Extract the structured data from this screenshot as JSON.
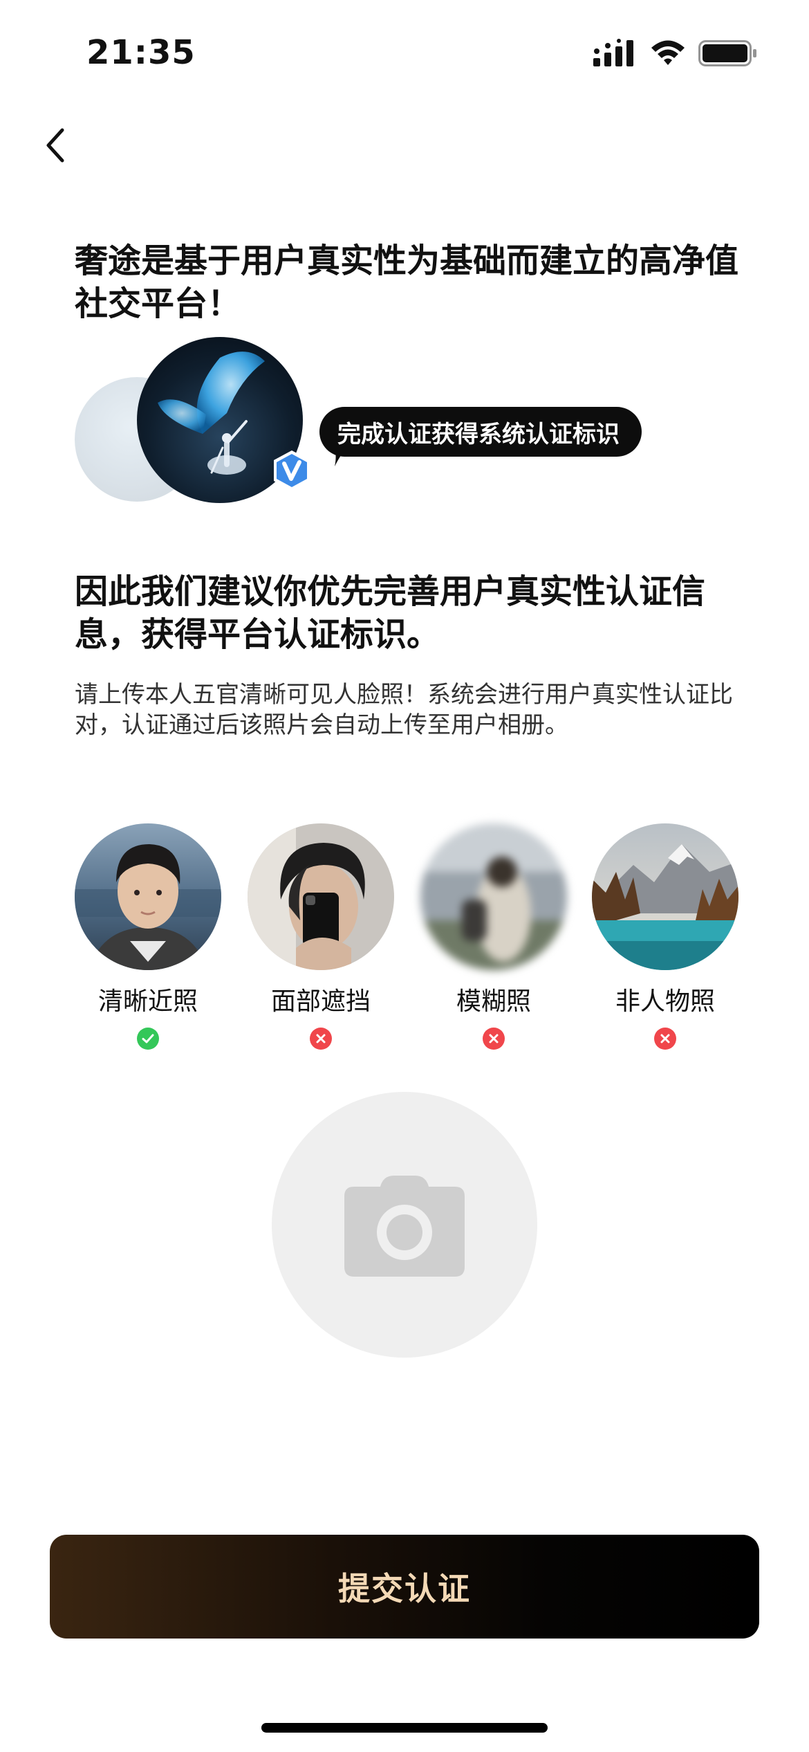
{
  "status_bar": {
    "time": "21:35",
    "icons": [
      "signal-icon",
      "wifi-icon",
      "battery-icon"
    ]
  },
  "nav": {
    "back_icon": "chevron-left-icon"
  },
  "intro": {
    "headline": "奢途是基于用户真实性为基础而建立的高净值社交平台！",
    "bubble_text": "完成认证获得系统认证标识",
    "badge_icon": "verified-v-badge-icon"
  },
  "recommend": {
    "headline": "因此我们建议你优先完善用户真实性认证信息，获得平台认证标识。",
    "description": "请上传本人五官清晰可见人脸照！系统会进行用户真实性认证比对，认证通过后该照片会自动上传至用户相册。"
  },
  "examples": [
    {
      "label": "清晰近照",
      "status": "valid",
      "status_icon": "check-circle-icon"
    },
    {
      "label": "面部遮挡",
      "status": "invalid",
      "status_icon": "x-circle-icon"
    },
    {
      "label": "模糊照",
      "status": "invalid",
      "status_icon": "x-circle-icon"
    },
    {
      "label": "非人物照",
      "status": "invalid",
      "status_icon": "x-circle-icon"
    }
  ],
  "upload": {
    "icon": "camera-icon"
  },
  "submit": {
    "label": "提交认证"
  },
  "colors": {
    "valid": "#34c759",
    "invalid": "#f0464b",
    "submit_text": "#f4d9b6",
    "badge_blue": "#3d8be8"
  }
}
